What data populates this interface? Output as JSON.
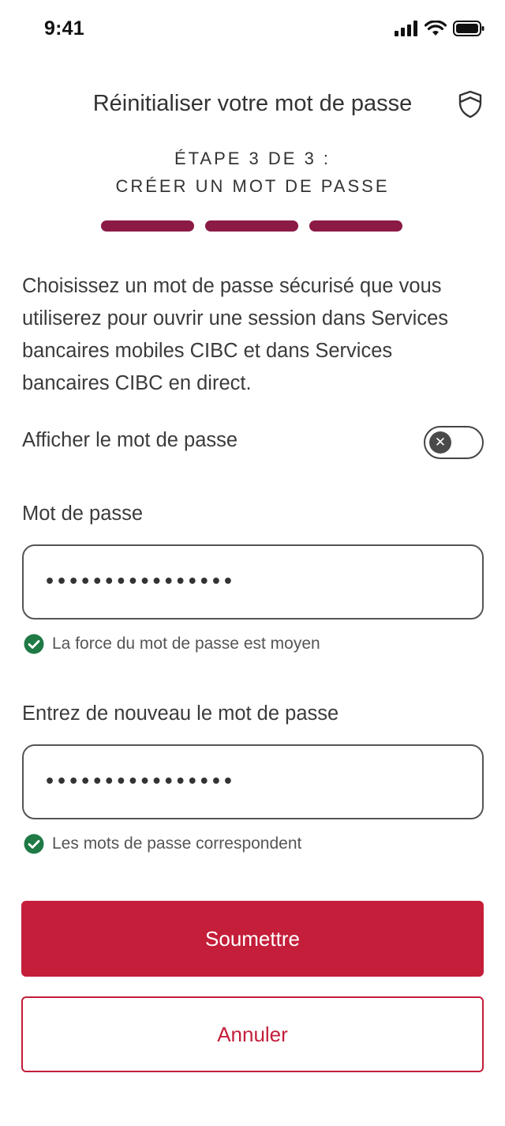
{
  "status_bar": {
    "time": "9:41",
    "icons": [
      "cellular-signal-icon",
      "wifi-icon",
      "battery-icon"
    ]
  },
  "header": {
    "title": "Réinitialiser votre mot de passe",
    "icon": "shield-icon"
  },
  "step": {
    "line1": "ÉTAPE 3 DE 3 :",
    "line2": "CRÉER UN MOT DE PASSE",
    "current": 3,
    "total": 3
  },
  "description": "Choisissez un mot de passe sécurisé que vous utiliserez pour ouvrir une session dans Services bancaires mobiles CIBC et dans Services bancaires CIBC en direct.",
  "show_password": {
    "label": "Afficher le mot de passe",
    "enabled": false
  },
  "password": {
    "label": "Mot de passe",
    "value": "••••••••••••••••",
    "validation": "La force du mot de passe est moyen"
  },
  "confirm_password": {
    "label": "Entrez de nouveau le mot de passe",
    "value": "••••••••••••••••",
    "validation": "Les mots de passe correspondent"
  },
  "actions": {
    "submit_label": "Soumettre",
    "cancel_label": "Annuler"
  },
  "colors": {
    "brand_red": "#c41e3a",
    "progress": "#8b1a45",
    "success": "#1f7a45"
  }
}
